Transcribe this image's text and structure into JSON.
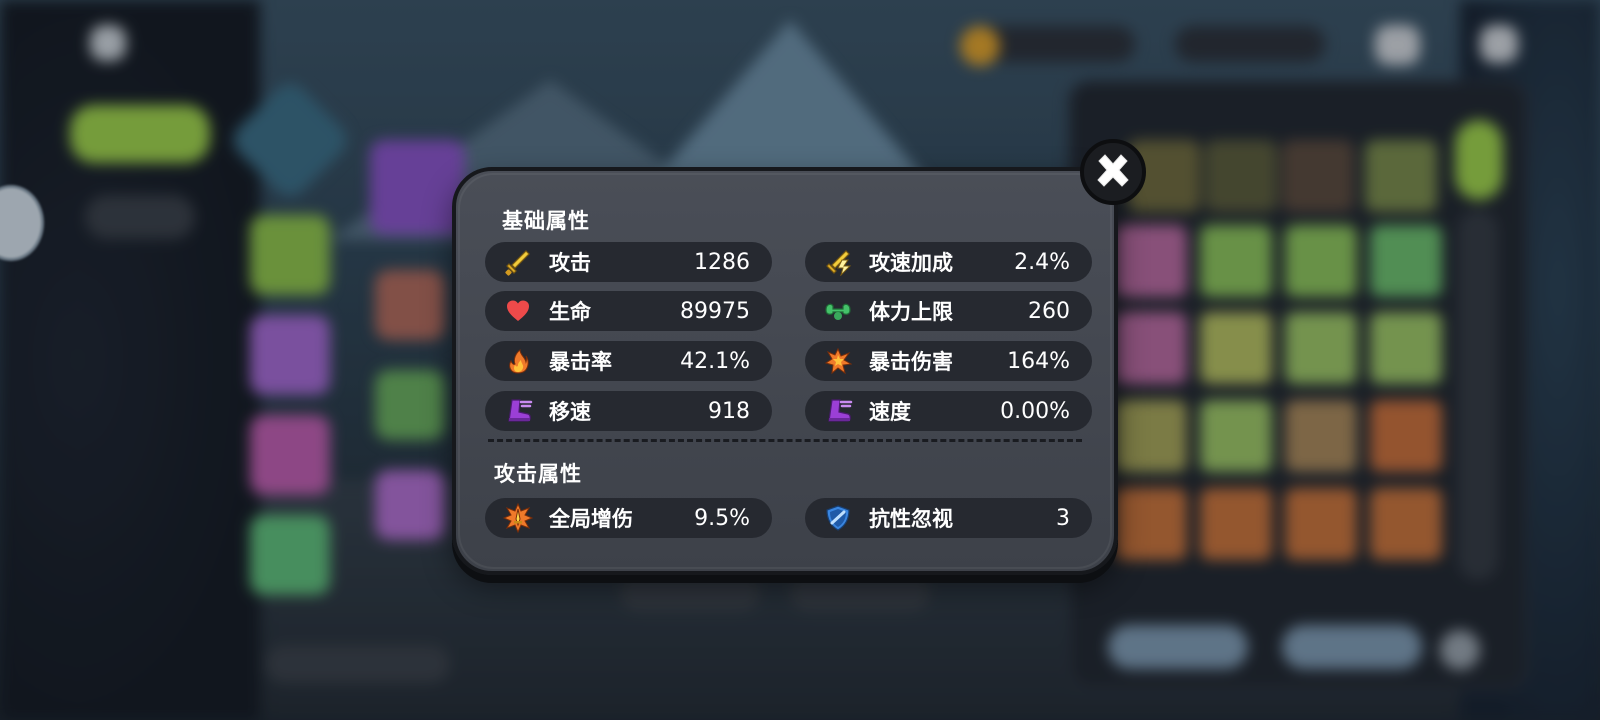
{
  "background": {
    "colors": {
      "lime": "#9fd34a",
      "purple": "#a36ad1",
      "pink": "#c85aa6",
      "green": "#5cbf6d",
      "orange": "#d7902e"
    }
  },
  "modal": {
    "sections": [
      {
        "title": "基础属性",
        "stats": [
          {
            "icon": "sword-icon",
            "label": "攻击",
            "value": "1286",
            "color": "#f2cc3c"
          },
          {
            "icon": "lightning-sword-icon",
            "label": "攻速加成",
            "value": "2.4%",
            "color": "#f2cc3c"
          },
          {
            "icon": "heart-icon",
            "label": "生命",
            "value": "89975",
            "color": "#ee4a4a"
          },
          {
            "icon": "muscle-icon",
            "label": "体力上限",
            "value": "260",
            "color": "#45c26a"
          },
          {
            "icon": "flame-icon",
            "label": "暴击率",
            "value": "42.1%",
            "color": "#f07a2a"
          },
          {
            "icon": "burst-icon",
            "label": "暴击伤害",
            "value": "164%",
            "color": "#f07a2a"
          },
          {
            "icon": "boot-icon",
            "label": "移速",
            "value": "918",
            "color": "#9b3fd6"
          },
          {
            "icon": "boot-icon",
            "label": "速度",
            "value": "0.00%",
            "color": "#9b3fd6"
          }
        ]
      },
      {
        "title": "攻击属性",
        "stats": [
          {
            "icon": "sword-burst-icon",
            "label": "全局增伤",
            "value": "9.5%",
            "color": "#f07a2a"
          },
          {
            "icon": "shield-icon",
            "label": "抗性忽视",
            "value": "3",
            "color": "#3a86e0"
          }
        ]
      }
    ]
  }
}
